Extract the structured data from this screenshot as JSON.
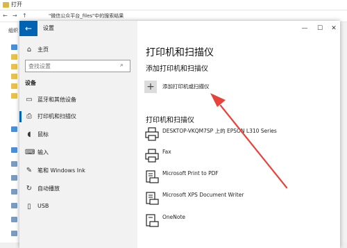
{
  "background": {
    "title": "打开",
    "path": "\"微信公众平台_files\"中的搜索结果",
    "organize": "组织",
    "nav_back": "←",
    "nav_forward": "→",
    "nav_up": "↑"
  },
  "settings": {
    "title": "设置",
    "back": "←",
    "search_placeholder": "查找设置",
    "section": "设备",
    "nav": [
      {
        "label": "主页",
        "icon": "⌂"
      },
      {
        "label": "蓝牙和其他设备",
        "icon": "▭"
      },
      {
        "label": "打印机和扫描仪",
        "icon": "⎙"
      },
      {
        "label": "鼠标",
        "icon": "◖"
      },
      {
        "label": "输入",
        "icon": "⌨"
      },
      {
        "label": "笔和 Windows Ink",
        "icon": "✎"
      },
      {
        "label": "自动播放",
        "icon": "↻"
      },
      {
        "label": "USB",
        "icon": "▯"
      }
    ],
    "window_controls": {
      "minimize": "—",
      "maximize": "☐",
      "close": "✕"
    }
  },
  "content": {
    "page_title": "打印机和扫描仪",
    "add_section": "添加打印机和扫描仪",
    "add_button": "添加打印机或扫描仪",
    "add_icon": "+",
    "printers_section": "打印机和扫描仪",
    "printers": [
      {
        "name": "DESKTOP-VKQM7SP 上的 EPSON L310 Series",
        "icon": "printer-icon"
      },
      {
        "name": "Fax",
        "icon": "printer-icon"
      },
      {
        "name": "Microsoft Print to PDF",
        "icon": "pdf-printer-icon"
      },
      {
        "name": "Microsoft XPS Document Writer",
        "icon": "xps-printer-icon"
      },
      {
        "name": "OneNote",
        "icon": "onenote-printer-icon"
      }
    ]
  },
  "colors": {
    "accent": "#0063b1",
    "annotation": "#e8433a"
  }
}
